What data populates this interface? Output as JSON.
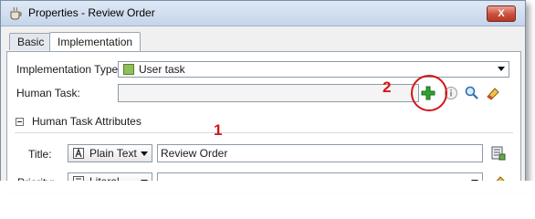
{
  "window": {
    "title": "Properties - Review Order",
    "close_label": "X"
  },
  "tabs": [
    {
      "label": "Basic"
    },
    {
      "label": "Implementation"
    }
  ],
  "form": {
    "implementation_type_label": "Implementation Type:",
    "implementation_type_value": "User task",
    "human_task_label": "Human Task:",
    "human_task_value": "",
    "section_title": "Human Task Attributes",
    "title_label": "Title:",
    "title_mode": "Plain Text",
    "title_value": "Review Order",
    "priority_label": "Priority:",
    "priority_mode": "Literal",
    "priority_value": ""
  },
  "annotations": {
    "marker_1": "1",
    "marker_2": "2"
  },
  "colors": {
    "annotation": "#d41515",
    "add_icon": "#2fa32f"
  }
}
